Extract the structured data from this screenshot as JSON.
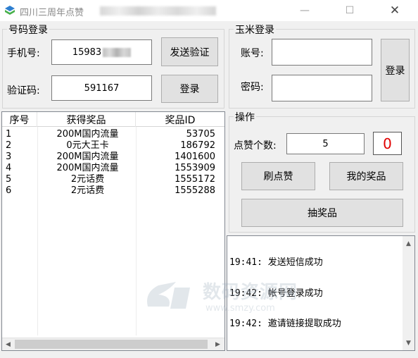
{
  "window": {
    "title": "四川三周年点赞",
    "minimize_glyph": "—",
    "maximize_glyph": "☐",
    "close_glyph": "✕"
  },
  "phone_login": {
    "group_label": "号码登录",
    "phone_label": "手机号:",
    "phone_value": "15983",
    "send_code_button": "发送验证",
    "code_label": "验证码:",
    "code_value": "591167",
    "login_button": "登录"
  },
  "corn_login": {
    "group_label": "玉米登录",
    "account_label": "账号:",
    "account_value": "",
    "password_label": "密码:",
    "password_value": "",
    "login_button": "登录"
  },
  "prize_table": {
    "columns": [
      "序号",
      "获得奖品",
      "奖品ID"
    ],
    "rows": [
      [
        "1",
        "200M国内流量",
        "53705"
      ],
      [
        "2",
        "0元大王卡",
        "186792"
      ],
      [
        "3",
        "200M国内流量",
        "1401600"
      ],
      [
        "4",
        "200M国内流量",
        "1553909"
      ],
      [
        "5",
        "2元话费",
        "1555172"
      ],
      [
        "6",
        "2元话费",
        "1555288"
      ]
    ]
  },
  "operation": {
    "group_label": "操作",
    "like_count_label": "点赞个数:",
    "like_count_value": "5",
    "counter_value": "0",
    "counter_color": "#e00000",
    "brush_likes_button": "刷点赞",
    "my_prizes_button": "我的奖品",
    "draw_button": "抽奖品"
  },
  "log": {
    "lines": [
      "19:41: 发送短信成功",
      "19:42: 帐号登录成功",
      "19:42: 邀请链接提取成功"
    ]
  },
  "watermark": {
    "text": "数码资源网",
    "url": "www.smzy.com"
  },
  "icons": {
    "app": "app-icon",
    "scroll_left": "scroll-left-icon",
    "scroll_right": "scroll-right-icon",
    "scroll_up": "scroll-up-icon",
    "scroll_down": "scroll-down-icon"
  }
}
